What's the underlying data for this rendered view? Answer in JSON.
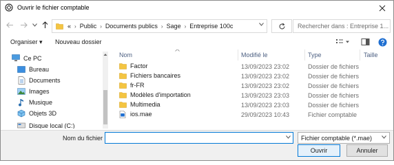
{
  "window": {
    "title": "Ouvrir le fichier comptable"
  },
  "address": {
    "overflow": "«",
    "crumbs": [
      "Public",
      "Documents publics",
      "Sage",
      "Entreprise 100c"
    ],
    "search_placeholder": "Rechercher dans : Entreprise 1..."
  },
  "toolbar": {
    "organize": "Organiser ▾",
    "new_folder": "Nouveau dossier"
  },
  "tree": [
    {
      "label": "Ce PC",
      "icon": "computer-icon"
    },
    {
      "label": "Bureau",
      "icon": "desktop-folder-icon"
    },
    {
      "label": "Documents",
      "icon": "documents-icon"
    },
    {
      "label": "Images",
      "icon": "images-icon"
    },
    {
      "label": "Musique",
      "icon": "music-icon"
    },
    {
      "label": "Objets 3D",
      "icon": "objects-3d-icon"
    },
    {
      "label": "Disque local (C:)",
      "icon": "drive-icon"
    }
  ],
  "columns": {
    "name": "Nom",
    "modified": "Modifié le",
    "type": "Type",
    "size": "Taille"
  },
  "files": [
    {
      "name": "Factor",
      "modified": "13/09/2023 23:02",
      "type": "Dossier de fichiers",
      "icon": "folder-icon"
    },
    {
      "name": "Fichiers bancaires",
      "modified": "13/09/2023 23:02",
      "type": "Dossier de fichiers",
      "icon": "folder-icon"
    },
    {
      "name": "fr-FR",
      "modified": "13/09/2023 23:02",
      "type": "Dossier de fichiers",
      "icon": "folder-icon"
    },
    {
      "name": "Modèles d'importation",
      "modified": "13/09/2023 23:03",
      "type": "Dossier de fichiers",
      "icon": "folder-icon"
    },
    {
      "name": "Multimedia",
      "modified": "13/09/2023 23:03",
      "type": "Dossier de fichiers",
      "icon": "folder-icon"
    },
    {
      "name": "ios.mae",
      "modified": "29/09/2023 10:43",
      "type": "Fichier comptable",
      "icon": "mae-file-icon"
    }
  ],
  "footer": {
    "filename_label": "Nom du fichier :",
    "filename_value": "",
    "filetype": "Fichier comptable (*.mae)",
    "open": "Ouvrir",
    "cancel": "Annuler"
  },
  "colors": {
    "accent": "#0078d7",
    "folder": "#f4c542",
    "header_text": "#4d6082"
  }
}
